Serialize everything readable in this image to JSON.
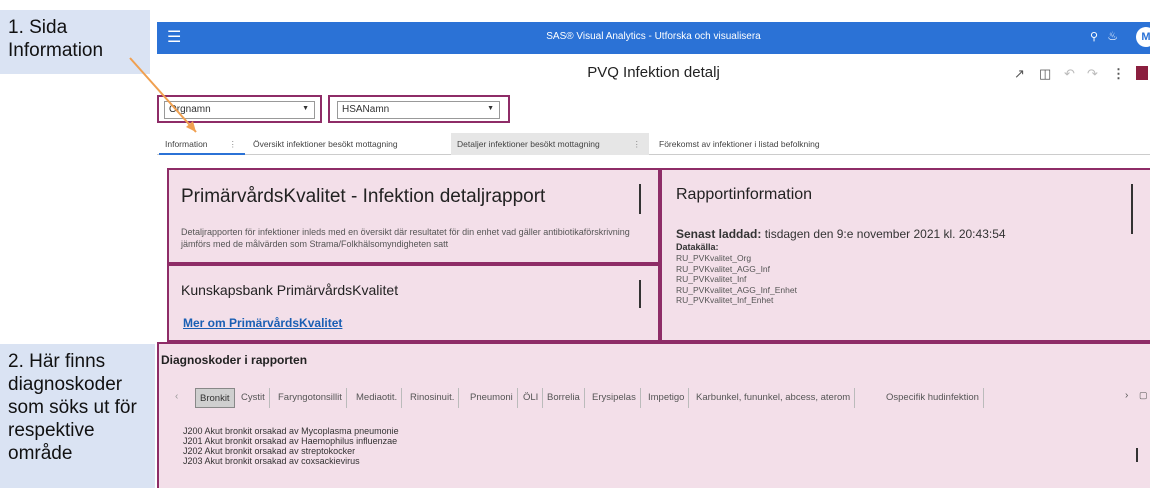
{
  "callouts": {
    "one": "1. Sida Information",
    "two": "2. Här finns diagnoskoder som söks ut för respektive område"
  },
  "topbar": {
    "menu_icon": "menu-icon",
    "title": "SAS® Visual Analytics - Utforska och visualisera",
    "avatar_letter": "M",
    "accent_color": "#2b72d6"
  },
  "report": {
    "title": "PVQ Infektion detalj"
  },
  "filters": {
    "org": "Orgnamn",
    "hsa": "HSANamn"
  },
  "tabs": [
    {
      "label": "Information"
    },
    {
      "label": "Översikt infektioner besökt mottagning"
    },
    {
      "label": "Detaljer infektioner besökt mottagning"
    },
    {
      "label": "Förekomst av infektioner i listad befolkning"
    }
  ],
  "main": {
    "heading": "PrimärvårdsKvalitet - Infektion detaljrapport",
    "description": "Detaljrapporten för infektioner inleds med en översikt där resultatet för din enhet vad gäller antibiotikaförskrivning jämförs med de målvärden som Strama/Folkhälsomyndigheten satt"
  },
  "knowledge": {
    "heading": "Kunskapsbank PrimärvårdsKvalitet",
    "link": "Mer om PrimärvårdsKvalitet"
  },
  "rapportinfo": {
    "heading": "Rapportinformation",
    "loaded_label": "Senast laddad:",
    "loaded_value": "tisdagen den 9:e november 2021 kl. 20:43:54",
    "source_label": "Datakälla:",
    "sources": [
      "RU_PVKvalitet_Org",
      "RU_PVKvalitet_AGG_Inf",
      "RU_PVKvalitet_Inf",
      "RU_PVKvalitet_AGG_Inf_Enhet",
      "RU_PVKvalitet_Inf_Enhet"
    ]
  },
  "diagnos": {
    "heading": "Diagnoskoder i rapporten",
    "tabs": [
      "Bronkit",
      "Cystit",
      "Faryngotonsillit",
      "Mediaotit.",
      "Rinosinuit.",
      "Pneumoni",
      "ÖLI",
      "Borrelia",
      "Erysipelas",
      "Impetigo",
      "Karbunkel, fununkel, abcess, aterom",
      "Ospecifik hudinfektion"
    ],
    "codes": [
      "J200 Akut bronkit orsakad av Mycoplasma pneumonie",
      "J201 Akut bronkit orsakad av Haemophilus influenzae",
      "J202 Akut bronkit orsakad av streptokocker",
      "J203 Akut bronkit orsakad av coxsackievirus"
    ]
  },
  "colors": {
    "panel_fill": "#f3dfe9",
    "panel_border": "#8e2c67",
    "arrow": "#f0a050"
  }
}
